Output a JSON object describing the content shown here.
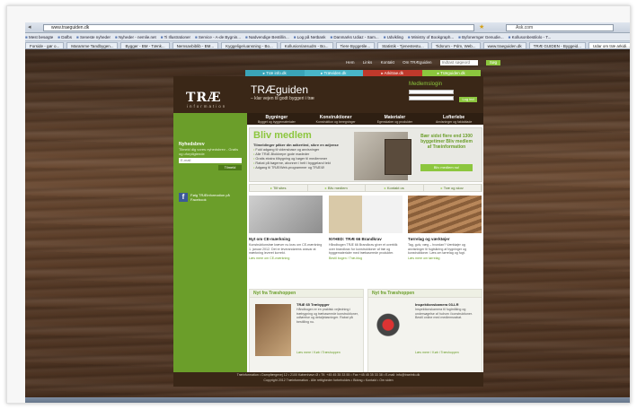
{
  "browser": {
    "url": "www.traeguiden.dk",
    "search_placeholder": "Ask.com",
    "bookmarks": [
      "Mest besøgte",
      "Dafbs",
      "Seneste nyheder",
      "Nyheder - nemlie.net",
      "Ti Illustrationer",
      "Service - A-de Bygnin...",
      "Nødvendige Bestillin...",
      "Log på Netbank",
      "Danmarks Udiaz - Sam...",
      "Udvikling",
      "Ministry of Bookgraph...",
      "Byfonernger Genudie...",
      "Kollusonbestilolo - T..."
    ],
    "tabs": [
      "Forside - gør o...",
      "Maramme Tandbygen...",
      "Bygger - BM - Tænk...",
      "Nemsavbiblib - BM...",
      "Kyggelige/uansning - Bo...",
      "Kollusion/ansudm - Bo...",
      "Tiere Byggetile...",
      "Statistik - Tjenestestu...",
      "Tidsrum - Pdm, Web...",
      "www.traeguiden.dk",
      "TRÆ GUIDEN - Byggeid...",
      "Udar om træ arkidi..."
    ],
    "active_tab_index": 11
  },
  "top_nav": {
    "links": [
      "Hem",
      "Links",
      "Kontakt",
      "Om TRÆguiden"
    ],
    "search_placeholder": "Indtast søgeord",
    "search_button": "Søg"
  },
  "color_tabs": [
    {
      "label": "▸ Træ info.dk",
      "color": "#3aa4b8"
    },
    {
      "label": "▸ Træviden.dk",
      "color": "#49b6c8"
    },
    {
      "label": "▸ Arkitrae.dk",
      "color": "#c0392b"
    },
    {
      "label": "▸ Træguiden.dk",
      "color": "#8cc63e"
    }
  ],
  "header": {
    "logo": "TRÆ",
    "logo_sub": "information",
    "guide_title": "TRÆguiden",
    "guide_sub": "– klar vejen til godt byggeri i træ",
    "login_title": "Medlemslogin",
    "login_button": "Log ind"
  },
  "menu": [
    {
      "title": "Bygninger",
      "sub": "Bygget og byggematerialer"
    },
    {
      "title": "Konstruktioner",
      "sub": "Konstruktion og beregninger"
    },
    {
      "title": "Materialer",
      "sub": "Egenskaber og produkter"
    },
    {
      "title": "Lofterlebe",
      "sub": "Anvisninger og faktablade"
    }
  ],
  "sidebar": {
    "newsletter_title": "Nyhedsbrev",
    "newsletter_text": "Tilmeld dig vores nyhedsbrev - Gratis og uforpligtende",
    "newsletter_input": "E-mail",
    "newsletter_button": "Tilmeld",
    "facebook_text": "Følg TRÆinformation på Facebook"
  },
  "banner": {
    "title": "Bliv medlem",
    "subtitle": "Tilmeldinger påker din adkertied, sikre en adjvnse",
    "bullets": [
      "Fuld adgang til vidensbase og anvisninger",
      "Alle TRÆ-Blokkrepe gode mødeder",
      "Gratis ekstra tilbygning og bøger til medlemmer",
      "Rabat på bøgerne, abonner i helt i byggeland tekt",
      "Adgang til TRÆ/Web-programmer og TRÆ/Ø"
    ],
    "badge_text": "Bær sidst flere end 1300 byggetimer Bliv medlem af Træinformation",
    "badge_button": "Bliv medlem nu!"
  },
  "actions": [
    "Tilf sites",
    "Bliv medlem",
    "Kontakt os",
    "Træ og skov"
  ],
  "cards": [
    {
      "title": "Nyt om CE-mærkning",
      "text": "Konstruktionstræ kræver nu krav om CE-mærkning 1. januar 2012. Det er leverandørens ansvar at mærkning leveret korrekt.",
      "link": "Læs mere om CE-mærkning"
    },
    {
      "title": "NYHED: TRÆ 66 Brandkrav",
      "text": "Håndbogen TRÆ 66 Brandkrav giver et overblik over brandkrav for konstruktioner af træ og byggematerialer med træbaserede produkter.",
      "link": "Bestil bogen / Træ-blog"
    },
    {
      "title": "Tørrelag og værktøjer",
      "text": "Tag, gulv, væg – hvordan? Værktøjer og anvisninger til fugtsikring af bygninger og konstruktioner. Læs om tørrelag og fugt.",
      "link": "Læs mere om tørrelag"
    }
  ],
  "news": [
    {
      "heading": "Nyt fra Træshoppen",
      "title": "TRÆ 65 Træbygger",
      "text": "Håndbogen er en praktisk vejledning i træbygning og træbaserede konstruktioner, udførelse og detaljeløsninger. Rabat på bestilling nu.",
      "link": "Læs mere / Køb i Træshoppen"
    },
    {
      "heading": "Nyt fra Træshoppen",
      "title": "Inspektionskamera 03-LR",
      "text": "Inspektionskamera til fugtmåling og undersøgelse af hulrum i konstruktioner. Bestil online med medlemsrabat.",
      "link": "Læs mere / Køb i Træshoppen"
    }
  ],
  "footer": {
    "line1": "Træinformation • Dampfærgevej 12 • 2100 København Ø • Tlf. +45 45 35 33 55 • Fax +45 45 35 33 38 • E-mail: info@traeinfo.dk",
    "line2": "Copyright 2012 Træinformation - Alle rettigheder forbeholdes • Bidrag • Kontakt • Om siden"
  }
}
